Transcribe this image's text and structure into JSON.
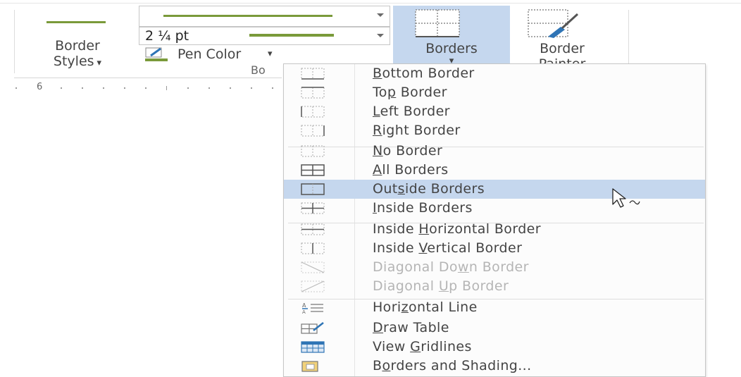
{
  "ribbon": {
    "border_styles_label_1": "Border",
    "border_styles_label_2": "Styles",
    "dropdown_glyph": "▾",
    "pen_weight_value": "2 ¼ pt",
    "pen_color_label": "Pen Color",
    "borders_label": "Borders",
    "border_painter_label_1": "Border",
    "border_painter_label_2": "Painter",
    "group_label_partial": "Bo"
  },
  "ruler": {
    "marker": "6"
  },
  "menu": {
    "items": [
      {
        "label": "Bottom Border",
        "mnemonic": "B",
        "icon": "border-bottom-icon",
        "disabled": false,
        "highlighted": false
      },
      {
        "label": "Top Border",
        "mnemonic": "p",
        "icon": "border-top-icon",
        "disabled": false,
        "highlighted": false
      },
      {
        "label": "Left Border",
        "mnemonic": "L",
        "icon": "border-left-icon",
        "disabled": false,
        "highlighted": false
      },
      {
        "label": "Right Border",
        "mnemonic": "R",
        "icon": "border-right-icon",
        "disabled": false,
        "highlighted": false
      },
      {
        "label": "No Border",
        "mnemonic": "N",
        "icon": "no-border-icon",
        "disabled": false,
        "highlighted": false
      },
      {
        "label": "All Borders",
        "mnemonic": "A",
        "icon": "all-borders-icon",
        "disabled": false,
        "highlighted": false
      },
      {
        "label": "Outside Borders",
        "mnemonic": "S",
        "icon": "outside-borders-icon",
        "disabled": false,
        "highlighted": true
      },
      {
        "label": "Inside Borders",
        "mnemonic": "I",
        "icon": "inside-borders-icon",
        "disabled": false,
        "highlighted": false
      },
      {
        "label": "Inside Horizontal Border",
        "mnemonic": "H",
        "icon": "inside-horizontal-border-icon",
        "disabled": false,
        "highlighted": false
      },
      {
        "label": "Inside Vertical Border",
        "mnemonic": "V",
        "icon": "inside-vertical-border-icon",
        "disabled": false,
        "highlighted": false
      },
      {
        "label": "Diagonal Down Border",
        "mnemonic": "W",
        "icon": "diagonal-down-border-icon",
        "disabled": true,
        "highlighted": false
      },
      {
        "label": "Diagonal Up Border",
        "mnemonic": "U",
        "icon": "diagonal-up-border-icon",
        "disabled": true,
        "highlighted": false
      },
      {
        "label": "Horizontal Line",
        "mnemonic": "Z",
        "icon": "horizontal-line-icon",
        "disabled": false,
        "highlighted": false
      },
      {
        "label": "Draw Table",
        "mnemonic": "D",
        "icon": "draw-table-icon",
        "disabled": false,
        "highlighted": false
      },
      {
        "label": "View Gridlines",
        "mnemonic": "G",
        "icon": "view-gridlines-icon",
        "disabled": false,
        "highlighted": false
      },
      {
        "label": "Borders and Shading...",
        "mnemonic": "O",
        "icon": "borders-and-shading-icon",
        "disabled": false,
        "highlighted": false
      }
    ]
  },
  "colors": {
    "accent_green": "#7a9a3a",
    "highlight_blue": "#c5d7ee",
    "text": "#444444",
    "disabled_text": "#b5b5b5"
  }
}
